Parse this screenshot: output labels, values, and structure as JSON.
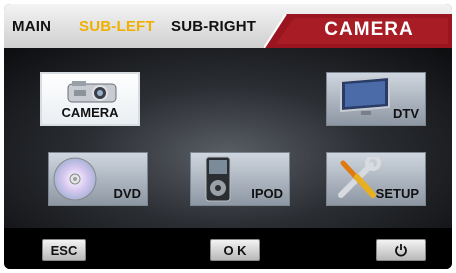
{
  "tabs": {
    "main": "MAIN",
    "sub_left": "SUB-LEFT",
    "sub_right": "SUB-RIGHT"
  },
  "title": "CAMERA",
  "tiles": {
    "camera": {
      "label": "CAMERA",
      "icon": "camera-icon",
      "selected": true
    },
    "dtv": {
      "label": "DTV",
      "icon": "tv-icon"
    },
    "dvd": {
      "label": "DVD",
      "icon": "disc-icon"
    },
    "ipod": {
      "label": "IPOD",
      "icon": "ipod-icon"
    },
    "setup": {
      "label": "SETUP",
      "icon": "tools-icon"
    }
  },
  "buttons": {
    "esc": "ESC",
    "ok": "O K",
    "power_icon": "power-icon"
  },
  "colors": {
    "accent": "#f0b000",
    "title_bg": "#a01820"
  }
}
